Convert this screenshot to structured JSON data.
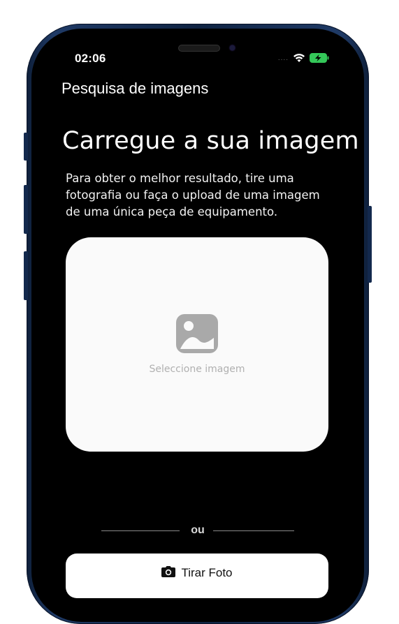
{
  "status_bar": {
    "time": "02:06",
    "signal": "....",
    "wifi_icon": "wifi-icon",
    "battery_icon": "battery-charging-icon",
    "battery_color": "#34c759"
  },
  "nav": {
    "title": "Pesquisa de imagens"
  },
  "main": {
    "heading": "Carregue a sua imagem",
    "description": "Para obter o melhor resultado, tire uma fotografia ou faça o upload de uma imagem de uma única peça de equipamento.",
    "picker": {
      "label": "Seleccione imagem",
      "icon": "image-icon"
    },
    "divider_text": "ou",
    "photo_button": {
      "label": "Tirar Foto",
      "icon": "camera-icon"
    }
  },
  "colors": {
    "background": "#000000",
    "card": "#fafafa",
    "frame": "#1f3a66"
  }
}
